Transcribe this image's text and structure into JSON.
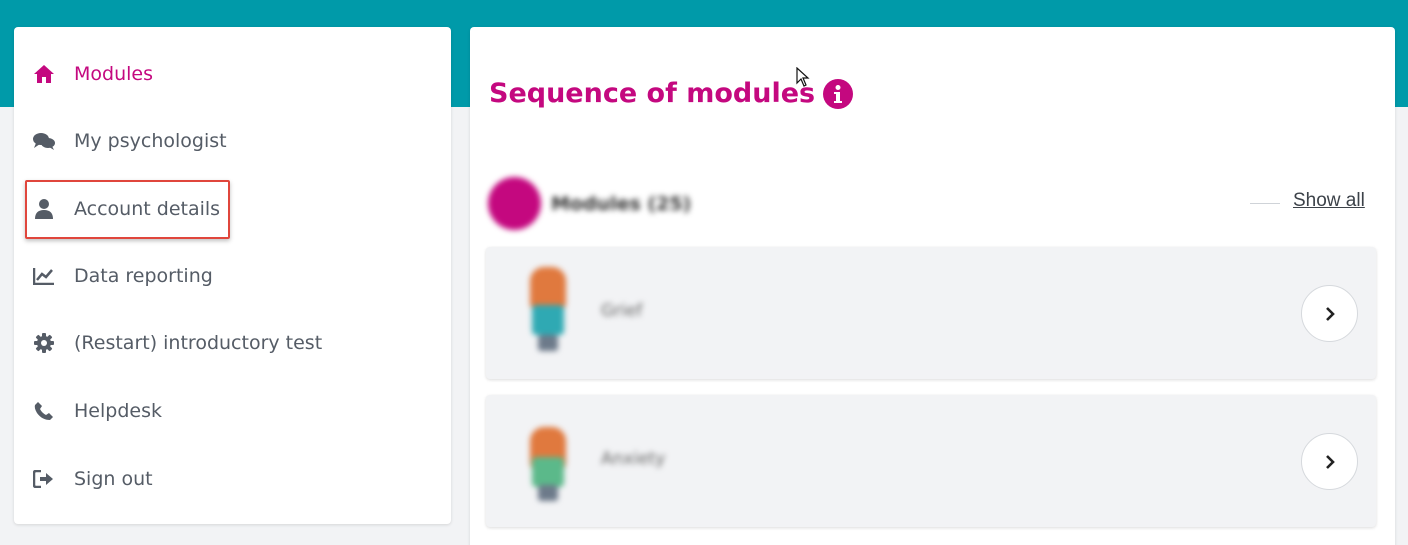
{
  "sidebar": {
    "items": [
      {
        "label": "Modules",
        "icon": "home-icon",
        "active": true
      },
      {
        "label": "My psychologist",
        "icon": "chat-icon"
      },
      {
        "label": "Account details",
        "icon": "user-icon",
        "highlighted": true
      },
      {
        "label": "Data reporting",
        "icon": "chart-icon"
      },
      {
        "label": "(Restart) introductory test",
        "icon": "gear-icon"
      },
      {
        "label": "Helpdesk",
        "icon": "phone-icon"
      },
      {
        "label": "Sign out",
        "icon": "sign-out-icon"
      }
    ]
  },
  "main": {
    "title": "Sequence of modules",
    "section": {
      "label": "Modules (25)",
      "show_all": "Show all"
    },
    "modules": [
      {
        "label": "Grief"
      },
      {
        "label": "Anxiety"
      }
    ]
  },
  "colors": {
    "brand": "#c4087f",
    "top_band": "#009aa9",
    "highlight_border": "#e0463c"
  }
}
